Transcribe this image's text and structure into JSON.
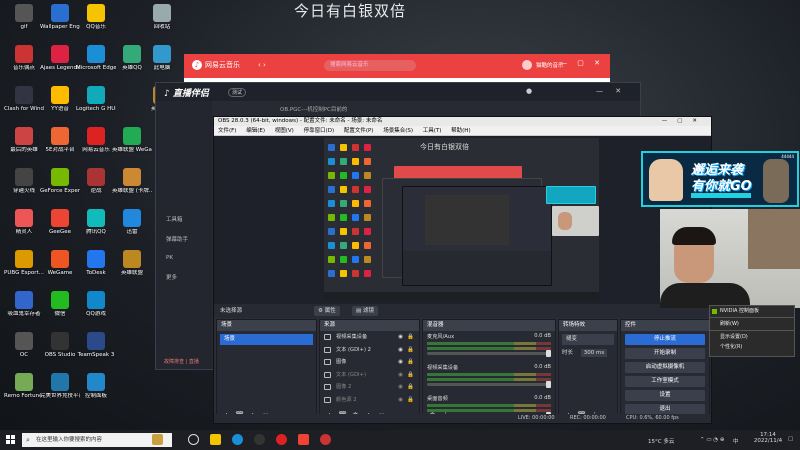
{
  "desktop": {
    "title": "今日有白银双倍",
    "icons": [
      {
        "label": "gif",
        "color": "#555"
      },
      {
        "label": "Wallpaper Engine:...",
        "color": "#2a6fcf"
      },
      {
        "label": "QQ音乐",
        "color": "#f5c400"
      },
      {
        "label": "回收站",
        "color": "#9aa"
      },
      {
        "label": "音乐偶点",
        "color": "#c33"
      },
      {
        "label": "Ajaes Legends",
        "color": "#d24"
      },
      {
        "label": "Microsoft Edge",
        "color": "#1a8fd8"
      },
      {
        "label": "英雄QQ",
        "color": "#3a7"
      },
      {
        "label": "此电脑",
        "color": "#39c"
      },
      {
        "label": "Clash for Windows...",
        "color": "#334"
      },
      {
        "label": "YY语音",
        "color": "#fb0"
      },
      {
        "label": "Logitech G HUB",
        "color": "#1ab"
      },
      {
        "label": "英雄联盟",
        "color": "#b82"
      },
      {
        "label": "最后的英雄",
        "color": "#c44"
      },
      {
        "label": "5E对战平台",
        "color": "#e63"
      },
      {
        "label": "网易云音乐",
        "color": "#d22"
      },
      {
        "label": "英雄联盟 WeGame版",
        "color": "#2a5"
      },
      {
        "label": "穿越火线",
        "color": "#444"
      },
      {
        "label": "GeForce Experience",
        "color": "#76b900"
      },
      {
        "label": "逆战",
        "color": "#a33"
      },
      {
        "label": "英雄联盟 (卡牌...)",
        "color": "#c83"
      },
      {
        "label": "精灵人",
        "color": "#e55"
      },
      {
        "label": "GeeGee",
        "color": "#e43"
      },
      {
        "label": "腾讯QQ",
        "color": "#1bb"
      },
      {
        "label": "迅雷",
        "color": "#28d"
      },
      {
        "label": "PUBG Esport...",
        "color": "#d90"
      },
      {
        "label": "WeGame",
        "color": "#e52"
      },
      {
        "label": "ToDesk",
        "color": "#27e"
      },
      {
        "label": "英雄联盟",
        "color": "#b82"
      },
      {
        "label": "吸血鬼幸存者",
        "color": "#36c"
      },
      {
        "label": "微信",
        "color": "#2b2"
      },
      {
        "label": "QQ游戏",
        "color": "#18c"
      },
      {
        "label": "OC",
        "color": "#555"
      },
      {
        "label": "OBS Studio",
        "color": "#333"
      },
      {
        "label": "TeamSpeak 3",
        "color": "#2a4a8a"
      },
      {
        "label": "Remo Fortune - ...",
        "color": "#7a5"
      },
      {
        "label": "完美世界竞技平台",
        "color": "#27a"
      },
      {
        "label": "控制面板",
        "color": "#28c"
      }
    ]
  },
  "netease": {
    "logo_label": "网易云音乐",
    "search_placeholder": "搜索网易云音乐",
    "user_label": "猫酷的音乐"
  },
  "zhibo": {
    "brand": "直播伴侣",
    "badge": "测试",
    "tabs": "OB.PGC---机控制PC目前的",
    "side_items": [
      "工具箱",
      "弹幕助手",
      "PK",
      "更多"
    ],
    "footer": "故障排查 | 直播"
  },
  "obs": {
    "title": "OBS 28.0.3 (64-bit, windows) - 配置文件: 未命名 - 场景: 未命名",
    "menu": [
      "文件(F)",
      "编辑(E)",
      "视图(V)",
      "停靠窗口(D)",
      "配置文件(P)",
      "场景集合(S)",
      "工具(T)",
      "帮助(H)"
    ],
    "preview_title": "今日有白银双倍",
    "no_source": "未选择源",
    "prop_btn": "属性",
    "filter_btn": "滤镜",
    "scenes": {
      "header": "场景",
      "selected": "场景"
    },
    "sources": {
      "header": "来源",
      "items": [
        "视频采集设备",
        "文本 (GDI+) 2",
        "图像",
        "文本 (GDI+)",
        "图像 2",
        "颜色源 2"
      ]
    },
    "mixer": {
      "header": "混音器",
      "channels": [
        {
          "name": "麦克风/Aux",
          "db": "0.0 dB"
        },
        {
          "name": "视频采集设备",
          "db": "0.0 dB"
        },
        {
          "name": "桌面音频",
          "db": "0.0 dB"
        }
      ]
    },
    "transitions": {
      "header": "转场特效",
      "type": "褪变",
      "duration_label": "时长",
      "duration": "300 ms"
    },
    "controls": {
      "header": "控件",
      "buttons": [
        "停止推流",
        "开始录制",
        "启动虚拟摄像机",
        "工作室模式",
        "设置",
        "退出"
      ]
    },
    "status": {
      "live": "LIVE: 00:00:00",
      "rec": "REC: 00:00:00",
      "cpu": "CPU: 0.6%, 60.00 fps"
    }
  },
  "promo": {
    "line1": "邂逅来袭",
    "line2": "有你就GO",
    "count": "44444"
  },
  "context_menu": {
    "items": [
      "NVIDIA 控制面板",
      "刷新(W)",
      "显示设置(D)",
      "个性化(R)"
    ]
  },
  "taskbar": {
    "search_placeholder": "在这里输入你要搜索的内容",
    "weather": "15°C 多云",
    "time": "17:14",
    "date": "2022/11/4",
    "ime": "中"
  }
}
